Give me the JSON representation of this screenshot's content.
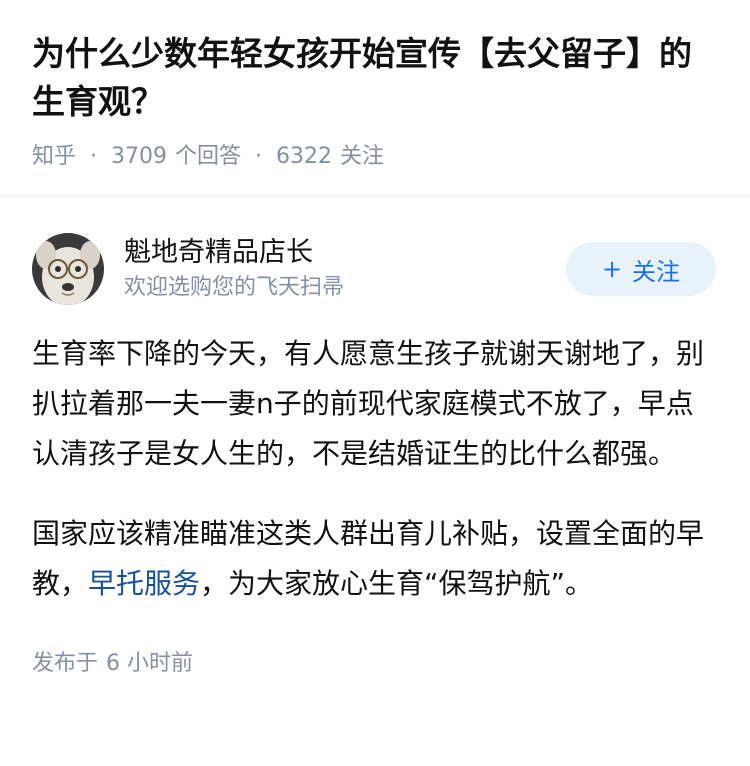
{
  "question": {
    "title": "为什么少数年轻女孩开始宣传【去父留子】的生育观？",
    "source": "知乎",
    "answer_count": "3709",
    "answer_count_label": "个回答",
    "follower_count": "6322",
    "follower_label": "关注",
    "separator": "·"
  },
  "author": {
    "name": "魁地奇精品店长",
    "bio": "欢迎选购您的飞天扫帚",
    "avatar_icon": "dog-with-glasses-avatar",
    "follow_plus": "+",
    "follow_label": "关注"
  },
  "answer": {
    "para1": "生育率下降的今天，有人愿意生孩子就谢天谢地了，别扒拉着那一夫一妻n子的前现代家庭模式不放了，早点认清孩子是女人生的，不是结婚证生的比什么都强。",
    "para2_before": "国家应该精准瞄准这类人群出育儿补贴，设置全面的早教，",
    "para2_link": "早托服务",
    "para2_after": "，为大家放心生育“保驾护航”。",
    "publish_label": "发布于",
    "publish_time": "6 小时前"
  },
  "colors": {
    "text": "#121212",
    "meta": "#8590a6",
    "accent": "#1772f6",
    "link": "#175199",
    "follow_bg": "#e8f2fb"
  }
}
